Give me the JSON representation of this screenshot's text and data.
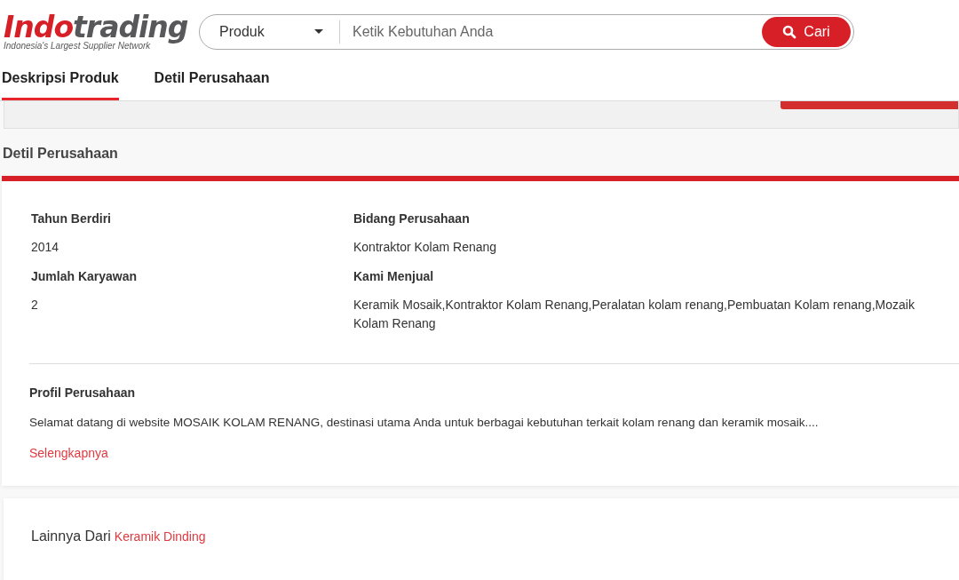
{
  "logo": {
    "brand_red": "Indo",
    "brand_grey": "trading",
    "tagline": "Indonesia's Largest Supplier Network"
  },
  "search": {
    "category": "Produk",
    "placeholder": "Ketik Kebutuhan Anda",
    "button": "Cari"
  },
  "tabs": [
    {
      "label": "Deskripsi Produk",
      "selected": true
    },
    {
      "label": "Detil Perusahaan",
      "selected": false
    }
  ],
  "section_title": "Detil Perusahaan",
  "details": [
    {
      "label": "Tahun Berdiri",
      "value": "2014"
    },
    {
      "label": "Bidang Perusahaan",
      "value": "Kontraktor Kolam Renang"
    },
    {
      "label": "Jumlah Karyawan",
      "value": "2"
    },
    {
      "label": "Kami Menjual",
      "value": "Keramik Mosaik,Kontraktor Kolam Renang,Peralatan kolam renang,Pembuatan Kolam renang,Mozaik Kolam Renang"
    }
  ],
  "profile": {
    "title": "Profil Perusahaan",
    "text": "Selamat datang di website MOSAIK KOLAM RENANG, destinasi utama Anda untuk berbagai kebutuhan terkait kolam renang dan keramik mosaik....",
    "link": "Selengkapnya"
  },
  "more": {
    "label": "Lainnya Dari",
    "link": "Keramik Dinding"
  }
}
